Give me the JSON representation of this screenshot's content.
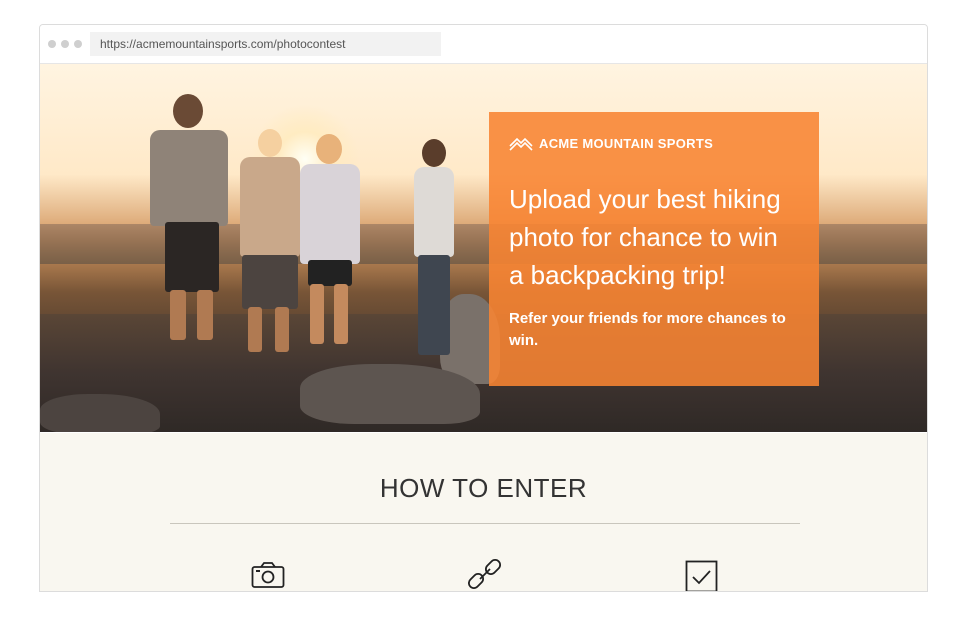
{
  "browser": {
    "url": "https://acmemountainsports.com/photocontest"
  },
  "hero": {
    "brand_name": "ACME MOUNTAIN SPORTS",
    "headline": "Upload your best hiking photo for chance to win a backpacking trip!",
    "subline": "Refer your friends for more chances to win.",
    "overlay_color": "#f88432"
  },
  "how_to_enter": {
    "title": "HOW TO ENTER",
    "steps": [
      {
        "icon": "camera-icon"
      },
      {
        "icon": "link-icon"
      },
      {
        "icon": "checkbox-icon"
      }
    ]
  }
}
